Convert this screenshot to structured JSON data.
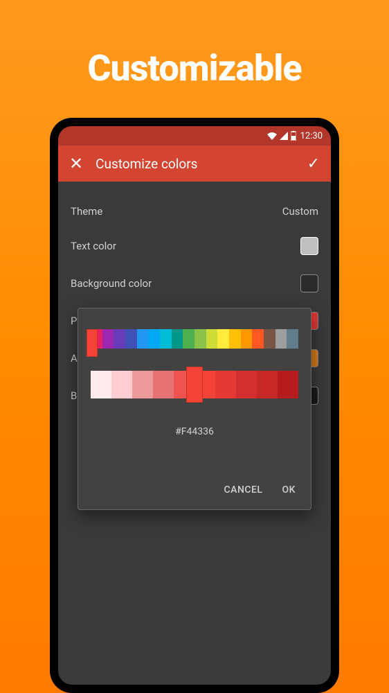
{
  "headline": "Customizable",
  "status": {
    "time": "12:30"
  },
  "appbar": {
    "title": "Customize colors"
  },
  "rows": {
    "theme_label": "Theme",
    "theme_value": "Custom",
    "text_color_label": "Text color",
    "background_color_label": "Background color",
    "primary_label": "Primary color",
    "appicon_label": "App icon color",
    "bottom_label": "Bottom navigation color"
  },
  "dialog": {
    "hex_value": "#F44336",
    "cancel": "CANCEL",
    "ok": "OK",
    "hue_colors": [
      "#e91e63",
      "#9c27b0",
      "#673ab7",
      "#3f51b5",
      "#2196f3",
      "#03a9f4",
      "#00bcd4",
      "#009688",
      "#4caf50",
      "#8bc34a",
      "#cddc39",
      "#ffeb3b",
      "#ffc107",
      "#ff9800",
      "#ff5722",
      "#795548",
      "#9e9e9e",
      "#607d8b"
    ],
    "shade_colors": [
      "#ffebee",
      "#ffcdd2",
      "#ef9a9a",
      "#e57373",
      "#ef5350",
      "#f44336",
      "#e53935",
      "#d32f2f",
      "#c62828",
      "#b71c1c"
    ]
  }
}
